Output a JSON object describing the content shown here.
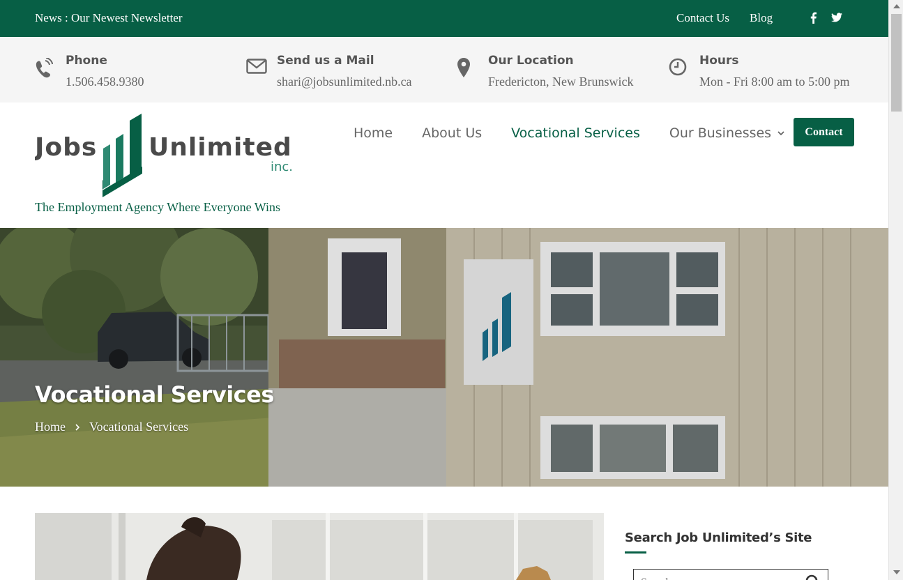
{
  "topbar": {
    "news": "News : Our Newest Newsletter",
    "links": [
      "Contact Us",
      "Blog"
    ],
    "social_icons": [
      "facebook-icon",
      "twitter-icon"
    ]
  },
  "infobar": {
    "phone": {
      "title": "Phone",
      "value": "1.506.458.9380",
      "icon": "phone-icon"
    },
    "mail": {
      "title": "Send us a Mail",
      "value": "shari@jobsunlimited.nb.ca",
      "icon": "envelope-icon"
    },
    "location": {
      "title": "Our Location",
      "value": "Fredericton, New Brunswick",
      "icon": "map-pin-icon"
    },
    "hours": {
      "title": "Hours",
      "value": "Mon - Fri 8:00 am to 5:00 pm",
      "icon": "clock-icon"
    }
  },
  "header": {
    "logo_text": "Jobs Unlimited",
    "logo_suffix": "inc.",
    "tagline": "The Employment Agency Where Everyone Wins",
    "nav": [
      "Home",
      "About Us",
      "Vocational Services",
      "Our Businesses"
    ],
    "active_nav": "Vocational Services",
    "contact_button": "Contact"
  },
  "hero": {
    "title": "Vocational Services",
    "breadcrumb": [
      "Home",
      "Vocational Services"
    ]
  },
  "sidebar": {
    "search_title": "Search Job Unlimited’s Site",
    "search_placeholder": "Search..."
  },
  "colors": {
    "brand_green": "#075f45",
    "info_bg": "#f5f5f5"
  }
}
